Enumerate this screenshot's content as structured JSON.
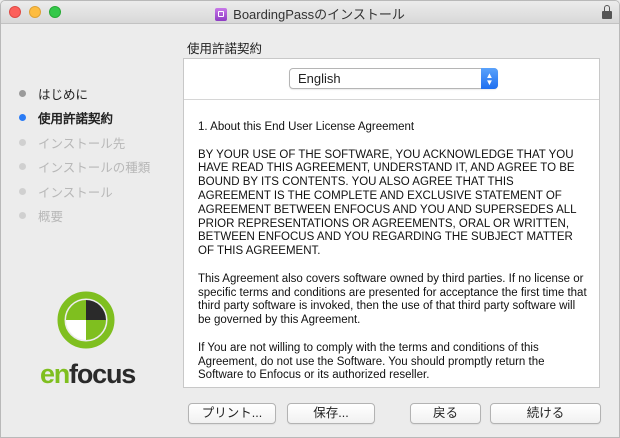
{
  "window": {
    "title": "BoardingPassのインストール"
  },
  "sidebar": {
    "steps": [
      {
        "label": "はじめに",
        "state": "done"
      },
      {
        "label": "使用許諾契約",
        "state": "active"
      },
      {
        "label": "インストール先",
        "state": "pending"
      },
      {
        "label": "インストールの種類",
        "state": "pending"
      },
      {
        "label": "インストール",
        "state": "pending"
      },
      {
        "label": "概要",
        "state": "pending"
      }
    ]
  },
  "logo": {
    "text_prefix": "en",
    "text_suffix": "focus",
    "colors": {
      "green": "#7fbf1f",
      "dark": "#2a2a2a"
    }
  },
  "main": {
    "section_title": "使用許諾契約",
    "language_select": {
      "value": "English"
    },
    "license_paragraphs": [
      "1. About this End User License Agreement",
      "BY YOUR USE OF THE SOFTWARE, YOU ACKNOWLEDGE THAT YOU HAVE READ THIS AGREEMENT, UNDERSTAND IT, AND AGREE TO BE BOUND BY ITS CONTENTS. YOU ALSO AGREE THAT THIS AGREEMENT IS THE COMPLETE AND EXCLUSIVE STATEMENT OF AGREEMENT BETWEEN ENFOCUS AND YOU AND SUPERSEDES ALL PRIOR REPRESENTATIONS OR AGREEMENTS, ORAL OR WRITTEN, BETWEEN ENFOCUS AND YOU REGARDING THE SUBJECT MATTER OF THIS AGREEMENT.",
      "This Agreement also covers software owned by third parties. If no license or specific terms and conditions are presented for acceptance the first time that third party software is invoked, then the use of that third party software will be governed by this Agreement.",
      "If You are not willing to comply with the terms and conditions of this Agreement, do not use the Software. You should promptly return the Software to Enfocus or its authorized reseller."
    ]
  },
  "buttons": {
    "print": "プリント...",
    "save": "保存...",
    "back": "戻る",
    "continue": "続ける"
  },
  "colors": {
    "accent": "#2a7bf5",
    "close": "#fc605b",
    "minimize": "#fdbc40",
    "maximize": "#34c84a"
  }
}
